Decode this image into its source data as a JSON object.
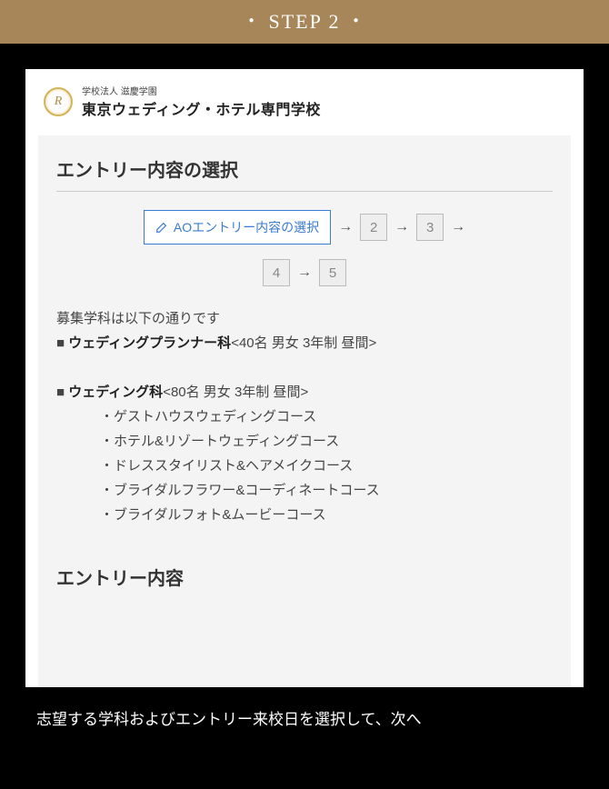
{
  "header": {
    "label": "STEP 2"
  },
  "brand": {
    "small": "学校法人 滋慶学園",
    "main": "東京ウェディング・ホテル専門学校",
    "logo_glyph": "R"
  },
  "panel": {
    "title": "エントリー内容の選択",
    "step_active": "AOエントリー内容の選択",
    "step2": "2",
    "step3": "3",
    "step4": "4",
    "step5": "5",
    "desc_intro": "募集学科は以下の通りです",
    "dept1_prefix": "■ ",
    "dept1_bold": "ウェディングプランナー科",
    "dept1_rest": "<40名 男女 3年制 昼間>",
    "dept2_prefix": "■ ",
    "dept2_bold": "ウェディング科",
    "dept2_rest": "<80名 男女 3年制 昼間>",
    "courses": [
      "・ゲストハウスウェディングコース",
      "・ホテル&リゾートウェディングコース",
      "・ドレススタイリスト&ヘアメイクコース",
      "・ブライダルフラワー&コーディネートコース",
      "・ブライダルフォト&ムービーコース"
    ],
    "section2_title": "エントリー内容"
  },
  "caption": "志望する学科およびエントリー来校日を選択して、次へ"
}
